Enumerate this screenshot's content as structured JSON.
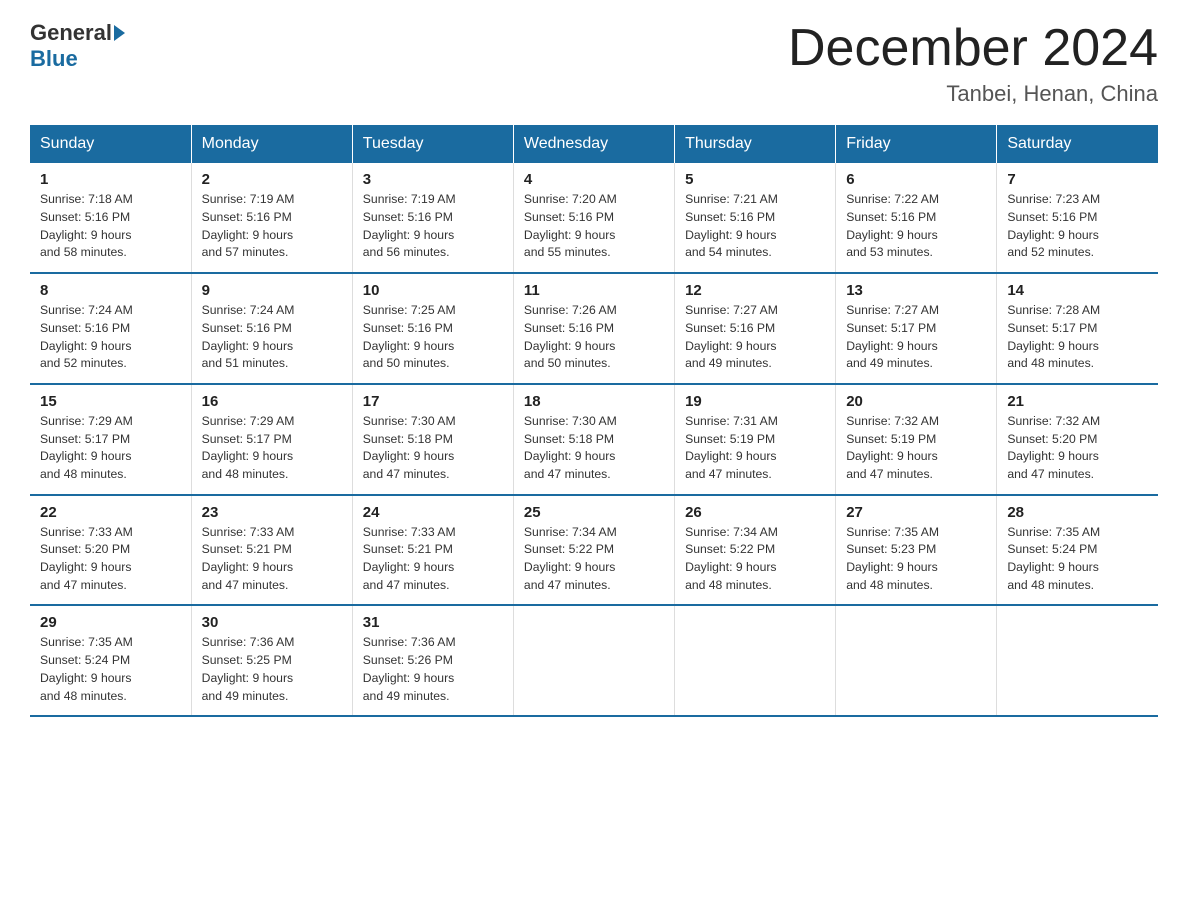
{
  "header": {
    "logo_general": "General",
    "logo_blue": "Blue",
    "month_title": "December 2024",
    "location": "Tanbei, Henan, China"
  },
  "weekdays": [
    "Sunday",
    "Monday",
    "Tuesday",
    "Wednesday",
    "Thursday",
    "Friday",
    "Saturday"
  ],
  "weeks": [
    [
      {
        "day": "1",
        "info": "Sunrise: 7:18 AM\nSunset: 5:16 PM\nDaylight: 9 hours\nand 58 minutes."
      },
      {
        "day": "2",
        "info": "Sunrise: 7:19 AM\nSunset: 5:16 PM\nDaylight: 9 hours\nand 57 minutes."
      },
      {
        "day": "3",
        "info": "Sunrise: 7:19 AM\nSunset: 5:16 PM\nDaylight: 9 hours\nand 56 minutes."
      },
      {
        "day": "4",
        "info": "Sunrise: 7:20 AM\nSunset: 5:16 PM\nDaylight: 9 hours\nand 55 minutes."
      },
      {
        "day": "5",
        "info": "Sunrise: 7:21 AM\nSunset: 5:16 PM\nDaylight: 9 hours\nand 54 minutes."
      },
      {
        "day": "6",
        "info": "Sunrise: 7:22 AM\nSunset: 5:16 PM\nDaylight: 9 hours\nand 53 minutes."
      },
      {
        "day": "7",
        "info": "Sunrise: 7:23 AM\nSunset: 5:16 PM\nDaylight: 9 hours\nand 52 minutes."
      }
    ],
    [
      {
        "day": "8",
        "info": "Sunrise: 7:24 AM\nSunset: 5:16 PM\nDaylight: 9 hours\nand 52 minutes."
      },
      {
        "day": "9",
        "info": "Sunrise: 7:24 AM\nSunset: 5:16 PM\nDaylight: 9 hours\nand 51 minutes."
      },
      {
        "day": "10",
        "info": "Sunrise: 7:25 AM\nSunset: 5:16 PM\nDaylight: 9 hours\nand 50 minutes."
      },
      {
        "day": "11",
        "info": "Sunrise: 7:26 AM\nSunset: 5:16 PM\nDaylight: 9 hours\nand 50 minutes."
      },
      {
        "day": "12",
        "info": "Sunrise: 7:27 AM\nSunset: 5:16 PM\nDaylight: 9 hours\nand 49 minutes."
      },
      {
        "day": "13",
        "info": "Sunrise: 7:27 AM\nSunset: 5:17 PM\nDaylight: 9 hours\nand 49 minutes."
      },
      {
        "day": "14",
        "info": "Sunrise: 7:28 AM\nSunset: 5:17 PM\nDaylight: 9 hours\nand 48 minutes."
      }
    ],
    [
      {
        "day": "15",
        "info": "Sunrise: 7:29 AM\nSunset: 5:17 PM\nDaylight: 9 hours\nand 48 minutes."
      },
      {
        "day": "16",
        "info": "Sunrise: 7:29 AM\nSunset: 5:17 PM\nDaylight: 9 hours\nand 48 minutes."
      },
      {
        "day": "17",
        "info": "Sunrise: 7:30 AM\nSunset: 5:18 PM\nDaylight: 9 hours\nand 47 minutes."
      },
      {
        "day": "18",
        "info": "Sunrise: 7:30 AM\nSunset: 5:18 PM\nDaylight: 9 hours\nand 47 minutes."
      },
      {
        "day": "19",
        "info": "Sunrise: 7:31 AM\nSunset: 5:19 PM\nDaylight: 9 hours\nand 47 minutes."
      },
      {
        "day": "20",
        "info": "Sunrise: 7:32 AM\nSunset: 5:19 PM\nDaylight: 9 hours\nand 47 minutes."
      },
      {
        "day": "21",
        "info": "Sunrise: 7:32 AM\nSunset: 5:20 PM\nDaylight: 9 hours\nand 47 minutes."
      }
    ],
    [
      {
        "day": "22",
        "info": "Sunrise: 7:33 AM\nSunset: 5:20 PM\nDaylight: 9 hours\nand 47 minutes."
      },
      {
        "day": "23",
        "info": "Sunrise: 7:33 AM\nSunset: 5:21 PM\nDaylight: 9 hours\nand 47 minutes."
      },
      {
        "day": "24",
        "info": "Sunrise: 7:33 AM\nSunset: 5:21 PM\nDaylight: 9 hours\nand 47 minutes."
      },
      {
        "day": "25",
        "info": "Sunrise: 7:34 AM\nSunset: 5:22 PM\nDaylight: 9 hours\nand 47 minutes."
      },
      {
        "day": "26",
        "info": "Sunrise: 7:34 AM\nSunset: 5:22 PM\nDaylight: 9 hours\nand 48 minutes."
      },
      {
        "day": "27",
        "info": "Sunrise: 7:35 AM\nSunset: 5:23 PM\nDaylight: 9 hours\nand 48 minutes."
      },
      {
        "day": "28",
        "info": "Sunrise: 7:35 AM\nSunset: 5:24 PM\nDaylight: 9 hours\nand 48 minutes."
      }
    ],
    [
      {
        "day": "29",
        "info": "Sunrise: 7:35 AM\nSunset: 5:24 PM\nDaylight: 9 hours\nand 48 minutes."
      },
      {
        "day": "30",
        "info": "Sunrise: 7:36 AM\nSunset: 5:25 PM\nDaylight: 9 hours\nand 49 minutes."
      },
      {
        "day": "31",
        "info": "Sunrise: 7:36 AM\nSunset: 5:26 PM\nDaylight: 9 hours\nand 49 minutes."
      },
      null,
      null,
      null,
      null
    ]
  ]
}
